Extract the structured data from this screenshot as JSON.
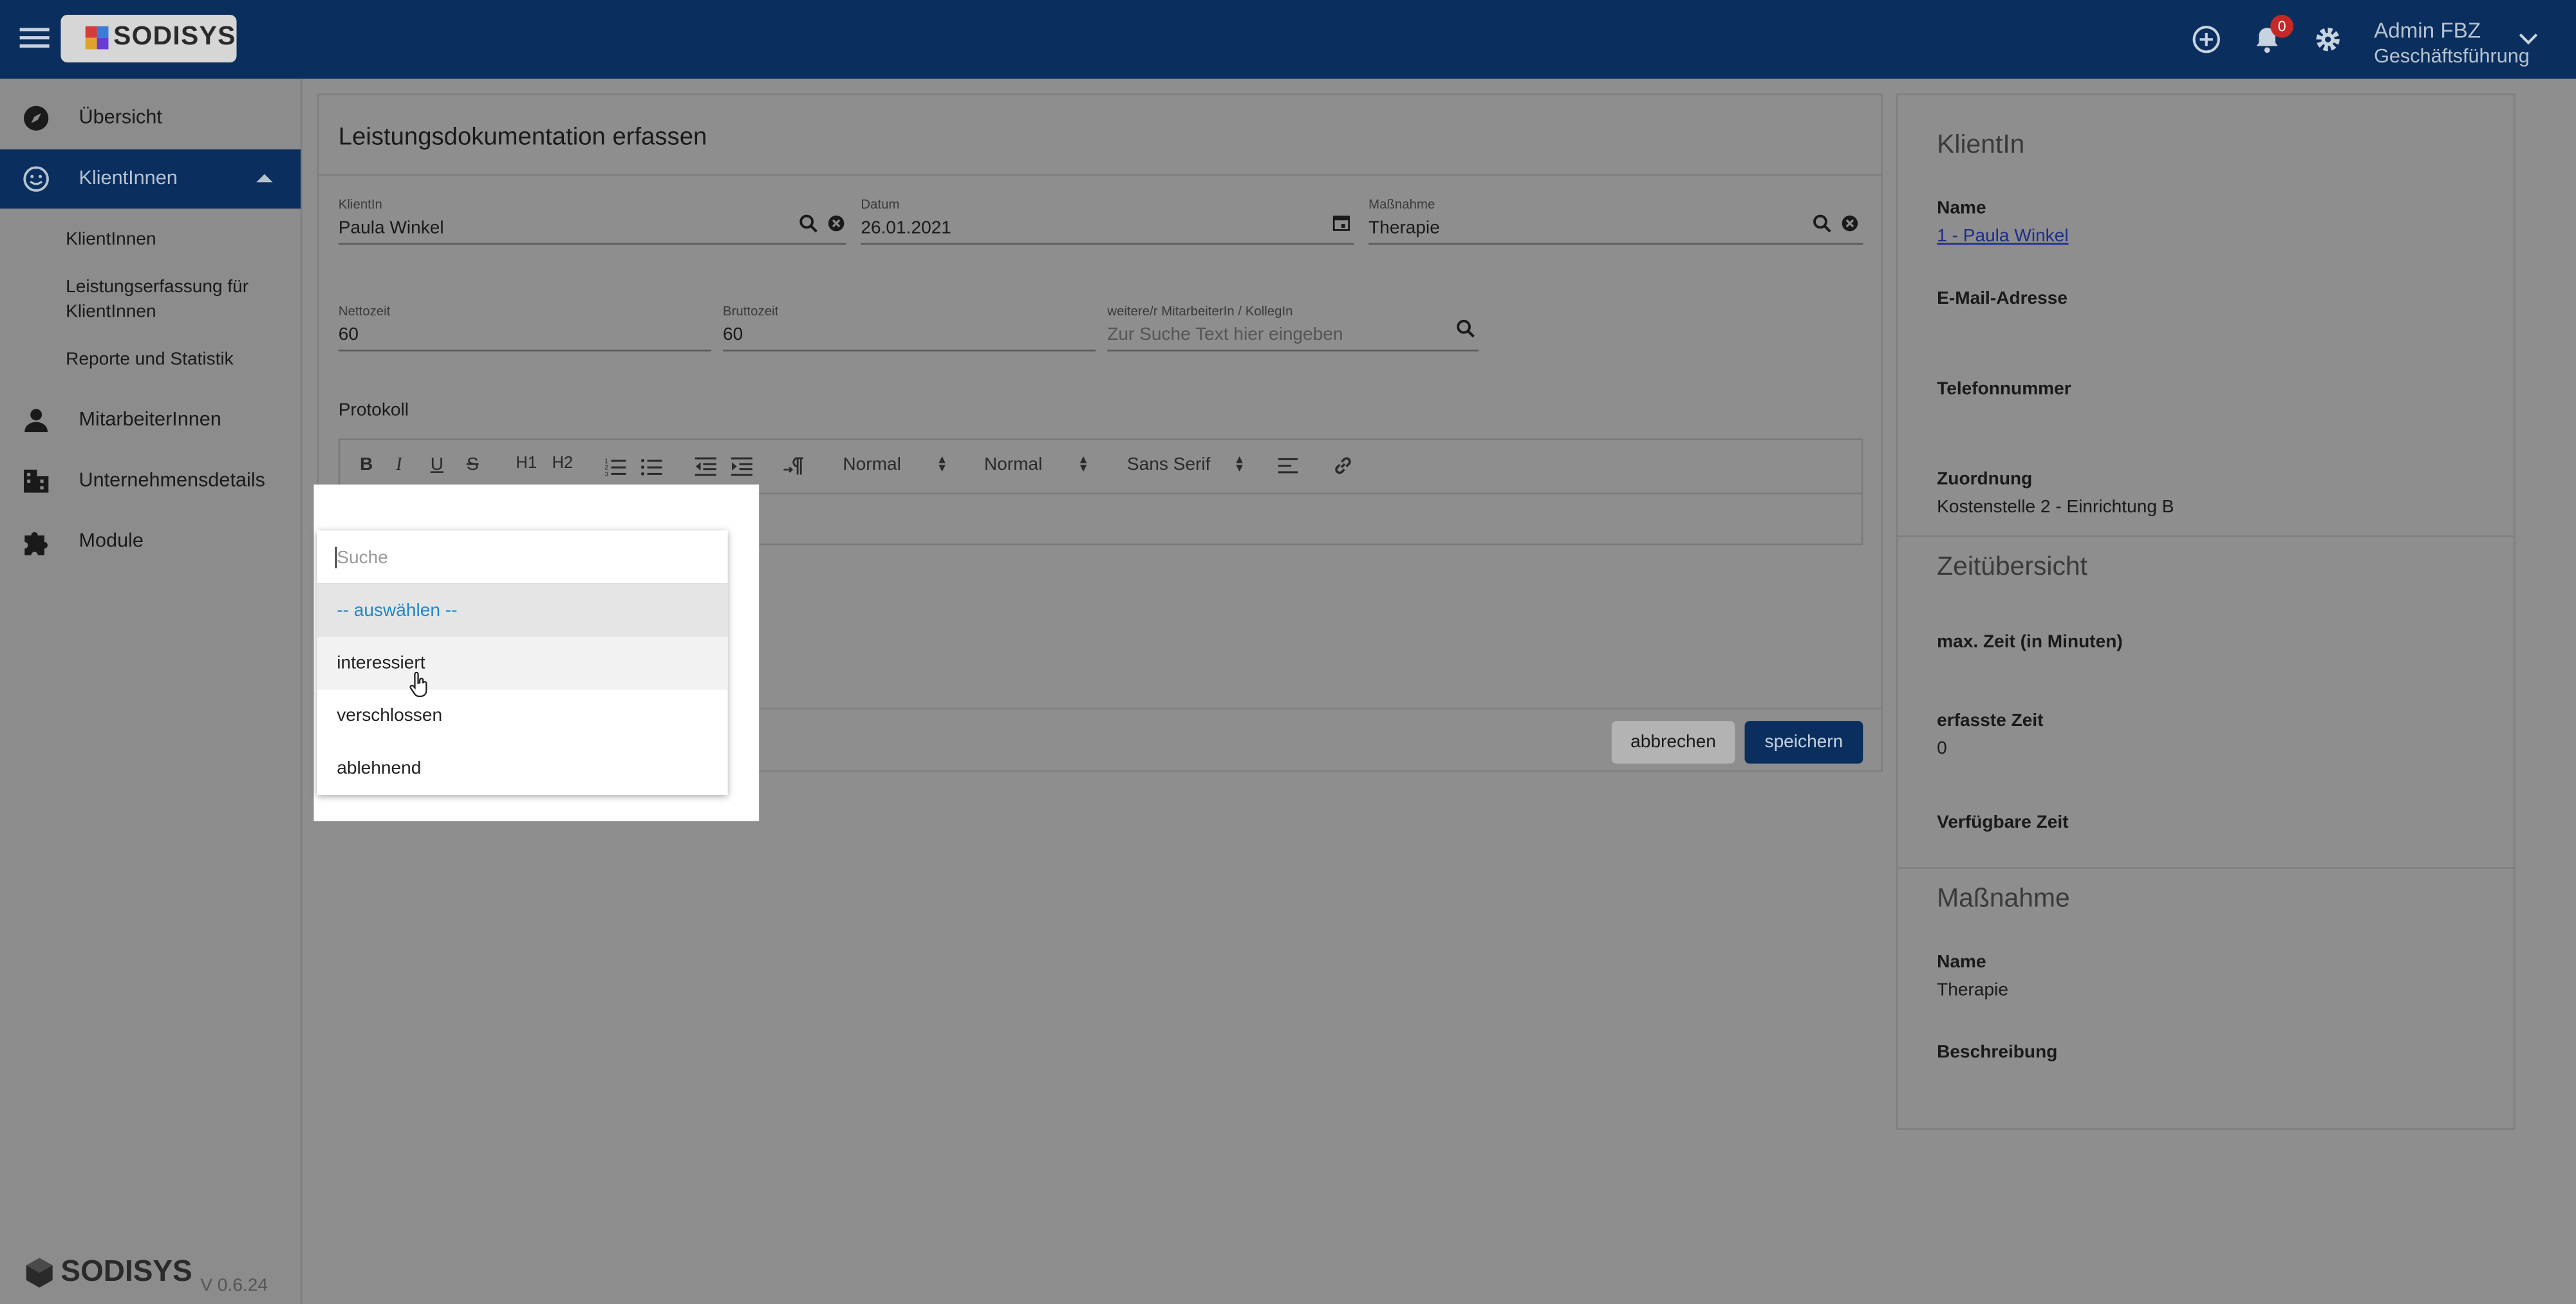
{
  "header": {
    "logo_text": "SODISYS",
    "notification_count": "0",
    "user_name": "Admin FBZ",
    "user_role": "Geschäftsführung"
  },
  "sidebar": {
    "items": [
      {
        "label": "Übersicht",
        "icon": "compass-icon"
      },
      {
        "label": "KlientInnen",
        "icon": "smiley-icon"
      },
      {
        "label": "MitarbeiterInnen",
        "icon": "person-icon"
      },
      {
        "label": "Unternehmensdetails",
        "icon": "building-icon"
      },
      {
        "label": "Module",
        "icon": "puzzle-icon"
      }
    ],
    "sub_items": [
      {
        "label": "KlientInnen"
      },
      {
        "label": "Leistungserfassung für KlientInnen"
      },
      {
        "label": "Reporte und Statistik"
      }
    ],
    "footer_logo": "SODISYS",
    "version": "V 0.6.24"
  },
  "form": {
    "title": "Leistungsdokumentation erfassen",
    "klientin": {
      "label": "KlientIn",
      "value": "Paula Winkel"
    },
    "datum": {
      "label": "Datum",
      "value": "26.01.2021"
    },
    "massnahme": {
      "label": "Maßnahme",
      "value": "Therapie"
    },
    "nettozeit": {
      "label": "Nettozeit",
      "value": "60"
    },
    "bruttozeit": {
      "label": "Bruttozeit",
      "value": "60"
    },
    "mitarbeiter": {
      "label": "weitere/r MitarbeiterIn / KollegIn",
      "placeholder": "Zur Suche Text hier eingeben"
    },
    "protokoll_label": "Protokoll",
    "toolbar": {
      "header_select": "Normal",
      "size_select": "Normal",
      "font_select": "Sans Serif",
      "h1": "H1",
      "h2": "H2",
      "bold": "B",
      "italic": "I",
      "underline": "U",
      "strike": "S"
    },
    "cancel_label": "abbrechen",
    "save_label": "speichern"
  },
  "info": {
    "klientin_title": "KlientIn",
    "name_label": "Name",
    "name_value": "1 - Paula Winkel",
    "email_label": "E-Mail-Adresse",
    "phone_label": "Telefonnummer",
    "zuordnung_label": "Zuordnung",
    "zuordnung_value": "Kostenstelle 2 - Einrichtung B",
    "zeit_title": "Zeitübersicht",
    "maxzeit_label": "max. Zeit (in Minuten)",
    "erfasst_label": "erfasste Zeit",
    "erfasst_value": "0",
    "verfuegbar_label": "Verfügbare Zeit",
    "massnahme_title": "Maßnahme",
    "m_name_label": "Name",
    "m_name_value": "Therapie",
    "beschreibung_label": "Beschreibung"
  },
  "dropdown": {
    "search_placeholder": "Suche",
    "options": [
      {
        "label": "-- auswählen --"
      },
      {
        "label": "interessiert"
      },
      {
        "label": "verschlossen"
      },
      {
        "label": "ablehnend"
      }
    ]
  },
  "colors": {
    "primary": "#0a2f5e",
    "overlay_bg": "#8e8e8e",
    "selected_option_text": "#1e88c7",
    "badge": "#c62828"
  }
}
